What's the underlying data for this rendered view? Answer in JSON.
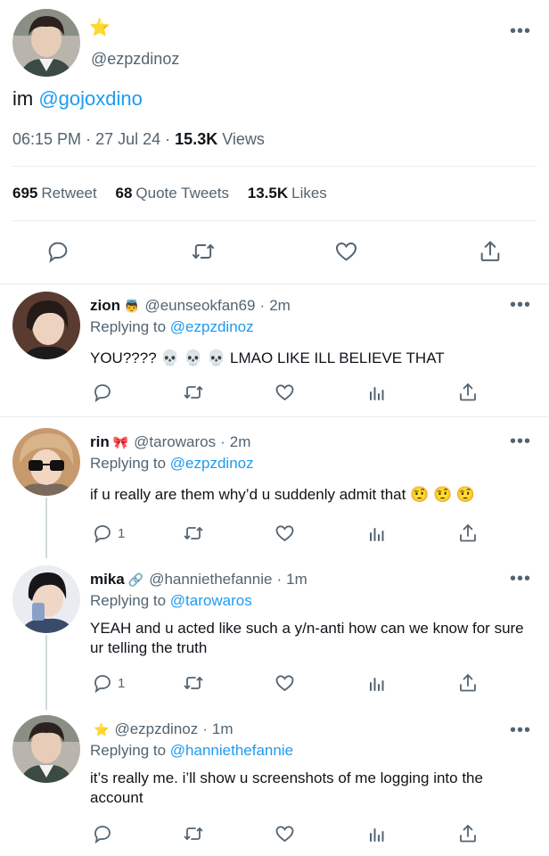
{
  "main_tweet": {
    "star": "⭐",
    "handle": "@ezpzdinoz",
    "text_prefix": "im",
    "text_mention": "@gojoxdino",
    "time": "06:15 PM",
    "date": "27 Jul 24",
    "dot": "·",
    "views_count": "15.3K",
    "views_label": "Views",
    "retweet_count": "695",
    "retweet_label": "Retweet",
    "quote_count": "68",
    "quote_label": "Quote Tweets",
    "likes_count": "13.5K",
    "likes_label": "Likes",
    "more": "•••"
  },
  "replies": [
    {
      "name": "zion",
      "emoji": "👼",
      "handle": "@eunseokfan69",
      "dot": "·",
      "time": "2m",
      "replying_prefix": "Replying to",
      "replying_to": "@ezpzdinoz",
      "text": "YOU???? 💀 💀 💀  LMAO LIKE ILL BELIEVE THAT",
      "reply_count": "",
      "more": "•••"
    },
    {
      "name": "rin",
      "emoji": "🎀",
      "handle": "@tarowaros",
      "dot": "·",
      "time": "2m",
      "replying_prefix": "Replying to",
      "replying_to": "@ezpzdinoz",
      "text": "if u really are them why’d u suddenly admit that 🤨 🤨 🤨",
      "reply_count": "1",
      "more": "•••"
    },
    {
      "name": "mika",
      "emoji": "🔗",
      "handle": "@hanniethefannie",
      "dot": "·",
      "time": "1m",
      "replying_prefix": "Replying to",
      "replying_to": "@tarowaros",
      "text": "YEAH and u acted like such a y/n-anti how can we know for sure ur telling the truth",
      "reply_count": "1",
      "more": "•••"
    },
    {
      "name": "",
      "emoji": "⭐",
      "handle": "@ezpzdinoz",
      "dot": "·",
      "time": "1m",
      "replying_prefix": "Replying to",
      "replying_to": "@hanniethefannie",
      "text": "it’s really me. i’ll show u screenshots of me logging into the account",
      "reply_count": "",
      "more": "•••"
    }
  ]
}
